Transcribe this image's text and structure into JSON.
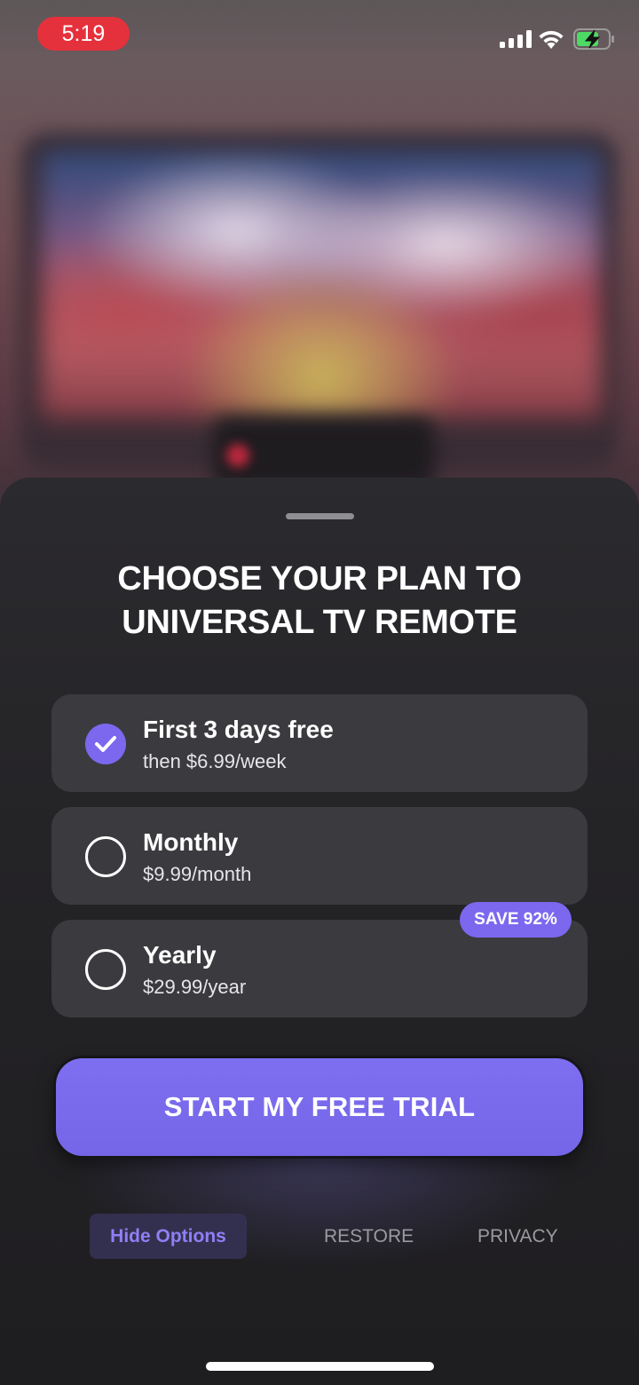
{
  "status_bar": {
    "time": "5:19",
    "time_pill_color": "#e5313c",
    "icons": [
      "cellular-signal-icon",
      "wifi-icon",
      "battery-charging-icon"
    ]
  },
  "paywall": {
    "title_line1": "CHOOSE YOUR PLAN TO",
    "title_line2": "UNIVERSAL TV REMOTE",
    "accent_color": "#7b68ee",
    "plans": [
      {
        "name": "First 3 days free",
        "price": "then $6.99/week",
        "selected": true
      },
      {
        "name": "Monthly",
        "price": "$9.99/month",
        "selected": false
      },
      {
        "name": "Yearly",
        "price": "$29.99/year",
        "selected": false,
        "badge": "SAVE 92%"
      }
    ],
    "cta_label": "START MY FREE TRIAL",
    "footer": {
      "hide_options": "Hide Options",
      "restore": "RESTORE",
      "privacy": "PRIVACY"
    }
  }
}
